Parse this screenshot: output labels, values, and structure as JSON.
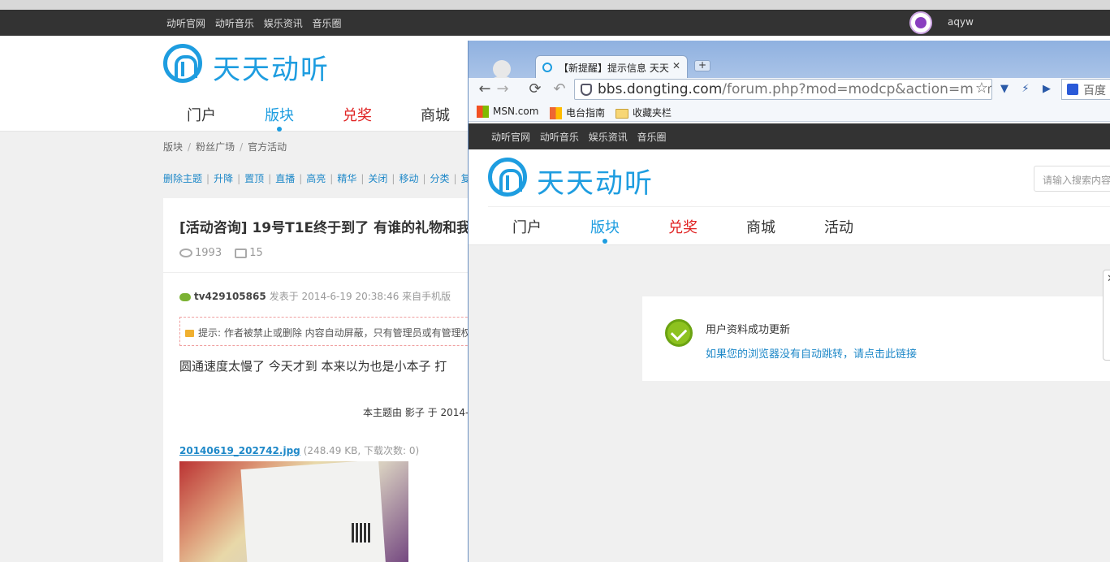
{
  "site": {
    "top_links": [
      "动听官网",
      "动听音乐",
      "娱乐资讯",
      "音乐圈"
    ],
    "username": "aqyw",
    "logo_text": "天天动听",
    "nav": [
      "门户",
      "版块",
      "兑奖",
      "商城",
      "活动"
    ],
    "nav_active": "版块",
    "nav_highlight": "兑奖",
    "accent_color": "#1e9de0"
  },
  "background_page": {
    "breadcrumb": [
      "版块",
      "粉丝广场",
      "官方活动"
    ],
    "mod_actions": [
      "删除主题",
      "升降",
      "置顶",
      "直播",
      "高亮",
      "精华",
      "关闭",
      "移动",
      "分类",
      "复制"
    ],
    "post": {
      "title": "[活动咨询] 19号T1E终于到了 有谁的礼物和我",
      "views": "1993",
      "replies": "15",
      "author": "tv429105865",
      "meta": "发表于 2014-6-19 20:38:46 来自手机版",
      "notice": "提示: 作者被禁止或删除 内容自动屏蔽，只有管理员或有管理权",
      "body": "圆通速度太慢了  今天才到  本来以为也是小本子 打",
      "edited_note": "本主题由 影子 于 2014-",
      "attachment_name": "20140619_202742.jpg",
      "attachment_meta": "(248.49 KB, 下载次数: 0)"
    }
  },
  "browser": {
    "tab_title": "【新提醒】提示信息 天天",
    "url_host": "bbs.dongting.com",
    "url_path": "/forum.php?mod=modcp&action=memb",
    "search_engine_label": "百度",
    "bookmarks": [
      "MSN.com",
      "电台指南",
      "收藏夹栏"
    ],
    "search_placeholder": "请输入搜索内容",
    "message_title": "用户资料成功更新",
    "message_link": "如果您的浏览器没有自动跳转，请点击此链接"
  }
}
